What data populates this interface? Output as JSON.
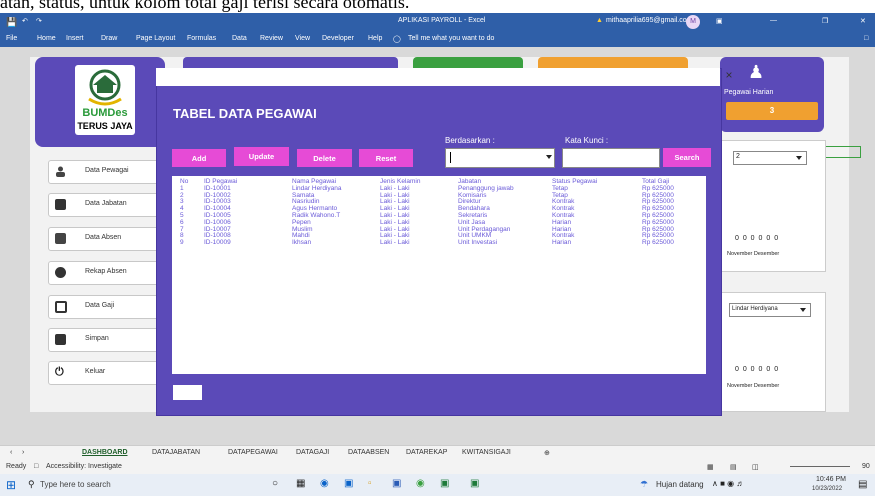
{
  "caption": "atan, status, untuk kolom total gaji terisi secara otomatis.",
  "window": {
    "title": "APLIKASI PAYROLL - Excel",
    "account": "mithaaprilia695@gmail.com",
    "avatar_initial": "M"
  },
  "ribbon_tabs": [
    "File",
    "Home",
    "Insert",
    "Draw",
    "Page Layout",
    "Formulas",
    "Data",
    "Review",
    "View",
    "Developer",
    "Help"
  ],
  "tell_me": "Tell me what you want to do",
  "dashboard": {
    "logo_name": "BUMDes",
    "logo_sub": "TERUS JAYA",
    "nav": [
      "Data Pewagai",
      "Data Jabatan",
      "Data Absen",
      "Rekap Absen",
      "Data Gaji",
      "Simpan",
      "Keluar"
    ],
    "right_card_title": "Pegawai Harian",
    "right_card_value": "3",
    "right_select_value": "2",
    "right_months_1": "November Desember",
    "right_nums_1": "0 0 0   0 0 0",
    "right_name_select": "Lindar Herdiyana",
    "right_nums_2": "0 0 0   0 0 0",
    "right_months_2": "November Desember"
  },
  "modal": {
    "title": "TABEL DATA PEGAWAI",
    "buttons": {
      "add": "Add",
      "update": "Update",
      "delete": "Delete",
      "reset": "Reset",
      "search": "Search"
    },
    "label_berdasarkan": "Berdasarkan :",
    "label_kata_kunci": "Kata Kunci :",
    "close": "×",
    "table": {
      "headers": [
        "No",
        "ID Pegawai",
        "Nama Pegawai",
        "Jenis Kelamin",
        "Jabatan",
        "Status Pegawai",
        "Total Gaji"
      ],
      "rows": [
        [
          "1",
          "ID-10001",
          "Lindar Herdiyana",
          "Laki - Laki",
          "Penanggung jawab",
          "Tetap",
          "Rp 625000"
        ],
        [
          "2",
          "ID-10002",
          "Samata",
          "Laki - Laki",
          "Komisaris",
          "Tetap",
          "Rp 625000"
        ],
        [
          "3",
          "ID-10003",
          "Nasriudin",
          "Laki - Laki",
          "Direktur",
          "Kontrak",
          "Rp 625000"
        ],
        [
          "4",
          "ID-10004",
          "Agus Hermanto",
          "Laki - Laki",
          "Bendahara",
          "Kontrak",
          "Rp 625000"
        ],
        [
          "5",
          "ID-10005",
          "Radik Wahono.T",
          "Laki - Laki",
          "Sekretaris",
          "Kontrak",
          "Rp 625000"
        ],
        [
          "6",
          "ID-10006",
          "Pepen",
          "Laki - Laki",
          "Unit Jasa",
          "Harian",
          "Rp 625000"
        ],
        [
          "7",
          "ID-10007",
          "Muslim",
          "Laki - Laki",
          "Unit Perdagangan",
          "Harian",
          "Rp 625000"
        ],
        [
          "8",
          "ID-10008",
          "Mahdi",
          "Laki - Laki",
          "Unit UMKM",
          "Kontrak",
          "Rp 625000"
        ],
        [
          "9",
          "ID-10009",
          "Ikhsan",
          "Laki - Laki",
          "Unit Investasi",
          "Harian",
          "Rp 625000"
        ]
      ]
    }
  },
  "sheet_tabs": [
    "DASHBOARD",
    "DATAJABATAN",
    "DATAPEGAWAI",
    "DATAGAJI",
    "DATAABSEN",
    "DATAREKAP",
    "KWITANSIGAJI"
  ],
  "status": {
    "ready": "Ready",
    "accessibility": "Accessibility: Investigate",
    "zoom": "90"
  },
  "taskbar": {
    "search_placeholder": "Type here to search",
    "weather": "Hujan datang",
    "time": "10:46 PM",
    "date": "10/23/2022"
  },
  "colors": {
    "excel_blue": "#2f5fa8",
    "modal_purple": "#5b4ab8",
    "button_pink": "#e64bd6",
    "table_text": "#6a5ad8",
    "badge_orange": "#f0a030"
  }
}
